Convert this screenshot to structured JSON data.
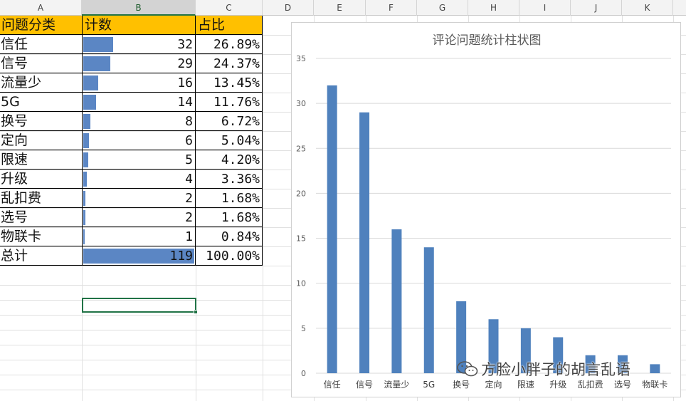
{
  "columns": [
    "A",
    "B",
    "C",
    "D",
    "E",
    "F",
    "G",
    "H",
    "I",
    "J",
    "K"
  ],
  "selected_column": "B",
  "table": {
    "headers": [
      "问题分类",
      "计数",
      "占比"
    ],
    "rows": [
      {
        "category": "信任",
        "count": 32,
        "percent": "26.89%"
      },
      {
        "category": "信号",
        "count": 29,
        "percent": "24.37%"
      },
      {
        "category": "流量少",
        "count": 16,
        "percent": "13.45%"
      },
      {
        "category": "5G",
        "count": 14,
        "percent": "11.76%"
      },
      {
        "category": "换号",
        "count": 8,
        "percent": "6.72%"
      },
      {
        "category": "定向",
        "count": 6,
        "percent": "5.04%"
      },
      {
        "category": "限速",
        "count": 5,
        "percent": "4.20%"
      },
      {
        "category": "升级",
        "count": 4,
        "percent": "3.36%"
      },
      {
        "category": "乱扣费",
        "count": 2,
        "percent": "1.68%"
      },
      {
        "category": "选号",
        "count": 2,
        "percent": "1.68%"
      },
      {
        "category": "物联卡",
        "count": 1,
        "percent": "0.84%"
      }
    ],
    "total": {
      "category": "总计",
      "count": 119,
      "percent": "100.00%"
    },
    "header_color": "#ffc000",
    "databar_color": "#5b86c4"
  },
  "chart_data": {
    "type": "bar",
    "title": "评论问题统计柱状图",
    "categories": [
      "信任",
      "信号",
      "流量少",
      "5G",
      "换号",
      "定向",
      "限速",
      "升级",
      "乱扣费",
      "选号",
      "物联卡"
    ],
    "values": [
      32,
      29,
      16,
      14,
      8,
      6,
      5,
      4,
      2,
      2,
      1
    ],
    "ylim": [
      0,
      35
    ],
    "yticks": [
      0,
      5,
      10,
      15,
      20,
      25,
      30,
      35
    ],
    "grid": true,
    "bar_color": "#4f81bd",
    "xlabel": "",
    "ylabel": ""
  },
  "watermark": {
    "text": "方脸小胖子的胡言乱语",
    "icon": "wechat-icon"
  }
}
